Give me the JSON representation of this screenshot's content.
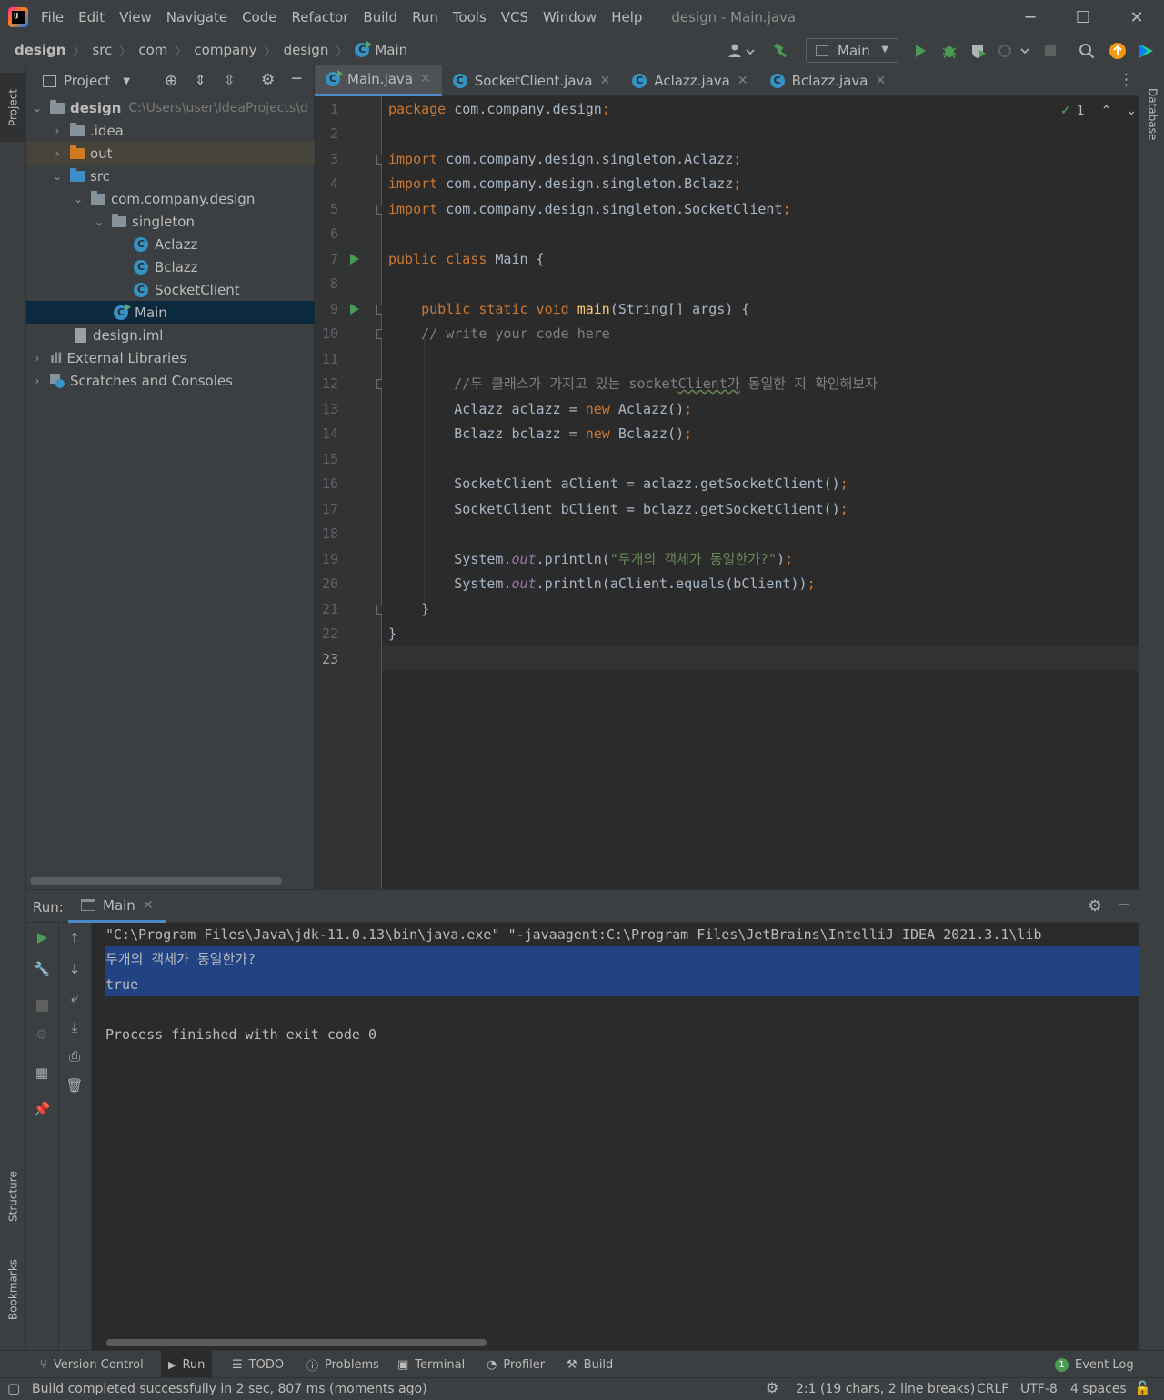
{
  "window": {
    "title": "design - Main.java",
    "menu": [
      "File",
      "Edit",
      "View",
      "Navigate",
      "Code",
      "Refactor",
      "Build",
      "Run",
      "Tools",
      "VCS",
      "Window",
      "Help"
    ]
  },
  "breadcrumb": [
    "design",
    "src",
    "com",
    "company",
    "design",
    "Main"
  ],
  "run_config": "Main",
  "side_tabs": {
    "left": [
      "Project",
      "Structure",
      "Bookmarks"
    ],
    "right": [
      "Database"
    ]
  },
  "project": {
    "header": "Project",
    "tree": [
      {
        "label": "design",
        "hint": "C:\\Users\\user\\IdeaProjects\\d",
        "depth": 0,
        "kind": "module-folder",
        "expanded": true
      },
      {
        "label": ".idea",
        "depth": 1,
        "kind": "folder",
        "expanded": false
      },
      {
        "label": "out",
        "depth": 1,
        "kind": "folder-orange",
        "expanded": false
      },
      {
        "label": "src",
        "depth": 1,
        "kind": "folder-blue",
        "expanded": true
      },
      {
        "label": "com.company.design",
        "depth": 2,
        "kind": "package",
        "expanded": true
      },
      {
        "label": "singleton",
        "depth": 3,
        "kind": "package",
        "expanded": true
      },
      {
        "label": "Aclazz",
        "depth": 4,
        "kind": "class"
      },
      {
        "label": "Bclazz",
        "depth": 4,
        "kind": "class"
      },
      {
        "label": "SocketClient",
        "depth": 4,
        "kind": "class"
      },
      {
        "label": "Main",
        "depth": 3,
        "kind": "main-class",
        "selected": true
      },
      {
        "label": "design.iml",
        "depth": 2,
        "kind": "file"
      },
      {
        "label": "External Libraries",
        "depth": 0,
        "kind": "libraries",
        "expanded": false
      },
      {
        "label": "Scratches and Consoles",
        "depth": 0,
        "kind": "scratches",
        "expanded": false
      }
    ]
  },
  "editor": {
    "tabs": [
      {
        "label": "Main.java",
        "active": true
      },
      {
        "label": "SocketClient.java",
        "active": false
      },
      {
        "label": "Aclazz.java",
        "active": false
      },
      {
        "label": "Bclazz.java",
        "active": false
      }
    ],
    "inspection_count": "1",
    "current_line": "23",
    "line_numbers": [
      "1",
      "2",
      "3",
      "4",
      "5",
      "6",
      "7",
      "8",
      "9",
      "10",
      "11",
      "12",
      "13",
      "14",
      "15",
      "16",
      "17",
      "18",
      "19",
      "20",
      "21",
      "22",
      "23"
    ],
    "tokens": {
      "l1_kw": "package",
      "l1_rest": " com.company.design",
      "l1_semi": ";",
      "l3_kw": "import",
      "l3_rest": " com.company.design.singleton.Aclazz",
      "l3_semi": ";",
      "l4_kw": "import",
      "l4_rest": " com.company.design.singleton.Bclazz",
      "l4_semi": ";",
      "l5_kw": "import",
      "l5_rest": " com.company.design.singleton.SocketClient",
      "l5_semi": ";",
      "l7_kw": "public class",
      "l7_rest": " Main {",
      "l9_indent": "    ",
      "l9_kw": "public static void",
      "l9_fn": "main",
      "l9_rest": "(String[] args) {",
      "l10_indent": "    ",
      "l10_cm": "// write your code here",
      "l12_indent": "        ",
      "l12_cm_a": "//두 클래스가 가지고 있는 socket",
      "l12_cm_typo": "Client가",
      "l12_cm_b": " 동일한 지 확인해보자",
      "l13_indent": "        ",
      "l13_a": "Aclazz aclazz = ",
      "l13_kw": "new",
      "l13_b": " Aclazz()",
      "l13_semi": ";",
      "l14_indent": "        ",
      "l14_a": "Bclazz bclazz = ",
      "l14_kw": "new",
      "l14_b": " Bclazz()",
      "l14_semi": ";",
      "l16_indent": "        ",
      "l16_a": "SocketClient aClient = aclazz.getSocketClient()",
      "l16_semi": ";",
      "l17_indent": "        ",
      "l17_a": "SocketClient bClient = bclazz.getSocketClient()",
      "l17_semi": ";",
      "l19_indent": "        ",
      "l19_a": "System.",
      "l19_sf": "out",
      "l19_b": ".println(",
      "l19_st": "\"두개의 객체가 동일한가?\"",
      "l19_c": ")",
      "l19_semi": ";",
      "l20_indent": "        ",
      "l20_a": "System.",
      "l20_sf": "out",
      "l20_b": ".println(aClient.equals(bClient))",
      "l20_semi": ";",
      "l21": "    }",
      "l22": "}"
    }
  },
  "run": {
    "label": "Run:",
    "tab": "Main",
    "console": [
      "\"C:\\Program Files\\Java\\jdk-11.0.13\\bin\\java.exe\" \"-javaagent:C:\\Program Files\\JetBrains\\IntelliJ IDEA 2021.3.1\\lib",
      "두개의 객체가 동일한가?",
      "true",
      "",
      "Process finished with exit code 0"
    ]
  },
  "bottom_tools": [
    "Version Control",
    "Run",
    "TODO",
    "Problems",
    "Terminal",
    "Profiler",
    "Build"
  ],
  "event_log": {
    "label": "Event Log",
    "count": "1"
  },
  "status": {
    "message": "Build completed successfully in 2 sec, 807 ms (moments ago)",
    "position": "2:1 (19 chars, 2 line breaks)",
    "line_sep": "CRLF",
    "encoding": "UTF-8",
    "indent": "4 spaces"
  },
  "colors": {
    "accent": "#4a88c7",
    "selection": "#214283",
    "run_green": "#499c54",
    "keyword": "#cc7832",
    "string": "#6a8759"
  }
}
